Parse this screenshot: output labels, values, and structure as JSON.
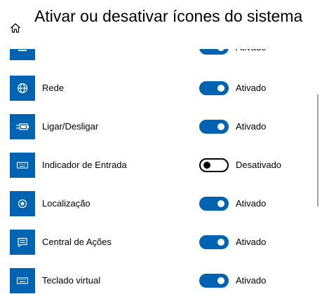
{
  "header": {
    "title": "Ativar ou desativar ícones do sistema",
    "home_icon": "home-icon"
  },
  "colors": {
    "accent": "#0063b1",
    "text": "#000000",
    "background": "#ffffff"
  },
  "items": [
    {
      "label": "",
      "icon": "partial-icon",
      "on": true,
      "state": "Ativado"
    },
    {
      "label": "Rede",
      "icon": "globe-icon",
      "on": true,
      "state": "Ativado"
    },
    {
      "label": "Ligar/Desligar",
      "icon": "battery-plug-icon",
      "on": true,
      "state": "Ativado"
    },
    {
      "label": "Indicador de Entrada",
      "icon": "keyboard-icon",
      "on": false,
      "state": "Desativado"
    },
    {
      "label": "Localização",
      "icon": "location-icon",
      "on": true,
      "state": "Ativado"
    },
    {
      "label": "Central de Ações",
      "icon": "action-center-icon",
      "on": true,
      "state": "Ativado"
    },
    {
      "label": "Teclado virtual",
      "icon": "touch-keyboard-icon",
      "on": true,
      "state": "Ativado"
    }
  ]
}
